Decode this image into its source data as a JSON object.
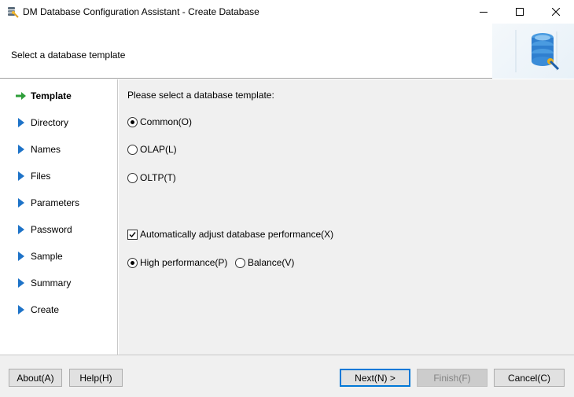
{
  "window": {
    "title": "DM Database Configuration Assistant - Create Database",
    "icon": "database-app-icon",
    "controls": [
      "minimize-icon",
      "maximize-icon",
      "close-icon"
    ]
  },
  "header": {
    "subtitle": "Select a database template",
    "art": "database-stack-icon"
  },
  "sidebar": {
    "items": [
      {
        "label": "Template",
        "active": true
      },
      {
        "label": "Directory",
        "active": false
      },
      {
        "label": "Names",
        "active": false
      },
      {
        "label": "Files",
        "active": false
      },
      {
        "label": "Parameters",
        "active": false
      },
      {
        "label": "Password",
        "active": false
      },
      {
        "label": "Sample",
        "active": false
      },
      {
        "label": "Summary",
        "active": false
      },
      {
        "label": "Create",
        "active": false
      }
    ],
    "active_arrow_color": "#2e9e3a",
    "arrow_color": "#1e73c8"
  },
  "main": {
    "prompt": "Please select a database template:",
    "templates": [
      {
        "label": "Common(O)",
        "selected": true
      },
      {
        "label": "OLAP(L)",
        "selected": false
      },
      {
        "label": "OLTP(T)",
        "selected": false
      }
    ],
    "auto_adjust": {
      "label": "Automatically adjust database performance(X)",
      "checked": true
    },
    "performance": [
      {
        "label": "High performance(P)",
        "selected": true
      },
      {
        "label": "Balance(V)",
        "selected": false
      }
    ]
  },
  "footer": {
    "about": "About(A)",
    "help": "Help(H)",
    "next": "Next(N) >",
    "finish": "Finish(F)",
    "cancel": "Cancel(C)"
  }
}
